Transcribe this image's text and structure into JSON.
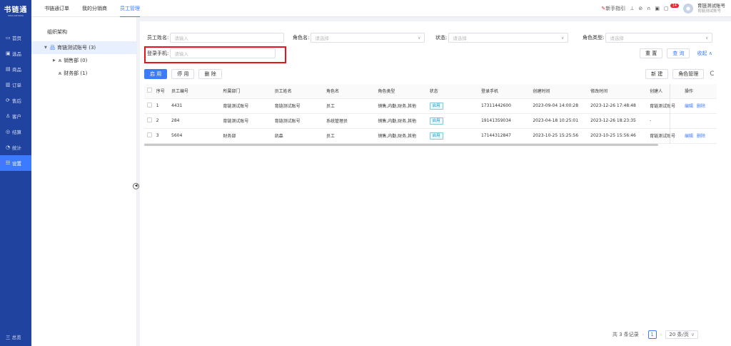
{
  "app": {
    "logo_title": "书链通",
    "logo_sub": "SHULIANTONG"
  },
  "nav": {
    "items": [
      {
        "icon": "▭",
        "label": "首页"
      },
      {
        "icon": "▣",
        "label": "选品"
      },
      {
        "icon": "▤",
        "label": "商品"
      },
      {
        "icon": "▥",
        "label": "订单"
      },
      {
        "icon": "⟳",
        "label": "售后"
      },
      {
        "icon": "♙",
        "label": "客户"
      },
      {
        "icon": "◎",
        "label": "结算"
      },
      {
        "icon": "◔",
        "label": "统计"
      },
      {
        "icon": "☷",
        "label": "设置"
      }
    ],
    "bottom": "三 总览"
  },
  "top_tabs": [
    "书链通订单",
    "我的分销商",
    "员工管理"
  ],
  "top_right": {
    "guide": "新手指引",
    "badge": "14",
    "username": "育链测试账号",
    "username_sub": "育链测试账号"
  },
  "org": {
    "title": "组织架构",
    "root": "育链测试账号 (3)",
    "children": [
      "销售部 (0)",
      "财务部 (1)"
    ]
  },
  "filters": {
    "emp_name_label": "员工姓名:",
    "emp_name_ph": "请输入",
    "role_label": "角色名:",
    "role_ph": "请选择",
    "status_label": "状态:",
    "status_ph": "请选择",
    "role_type_label": "角色类型:",
    "role_type_ph": "请选择",
    "phone_label": "登录手机:",
    "phone_ph": "请输入",
    "reset": "重 置",
    "query": "查 询",
    "collapse": "收起 ∧"
  },
  "actions": {
    "enable": "启 用",
    "disable": "停 用",
    "delete": "删 除",
    "new": "新 建",
    "role_mgmt": "角色管理",
    "refresh": "C"
  },
  "table": {
    "headers": [
      "",
      "序号",
      "员工编号",
      "所属部门",
      "员工姓名",
      "角色名",
      "角色类型",
      "状态",
      "登录手机",
      "创建时间",
      "修改时间",
      "创建人",
      "操作"
    ],
    "rows": [
      [
        "1",
        "4431",
        "育链测试账号",
        "育链测试账号",
        "员工",
        "销售,内勤,财务,其他",
        "启用",
        "17311442600",
        "2023-09-04 14:00:28",
        "2023-12-26 17:48:48",
        "育链测试账号",
        "编辑",
        "删除"
      ],
      [
        "2",
        "284",
        "育链测试账号",
        "育链测试账号",
        "系统管理员",
        "销售,内勤,财务,其他",
        "启用",
        "19141359034",
        "2023-04-18 10:25:01",
        "2023-12-26 18:23:35",
        "-",
        "",
        ""
      ],
      [
        "3",
        "5604",
        "财务部",
        "凯森",
        "员工",
        "销售,内勤,财务,其他",
        "启用",
        "17144312847",
        "2023-10-25 15:25:56",
        "2023-10-25 15:56:46",
        "育链测试账号",
        "编辑",
        "删除"
      ]
    ]
  },
  "pager": {
    "total": "共 3 条记录",
    "page": "1",
    "size": "20 条/页"
  }
}
